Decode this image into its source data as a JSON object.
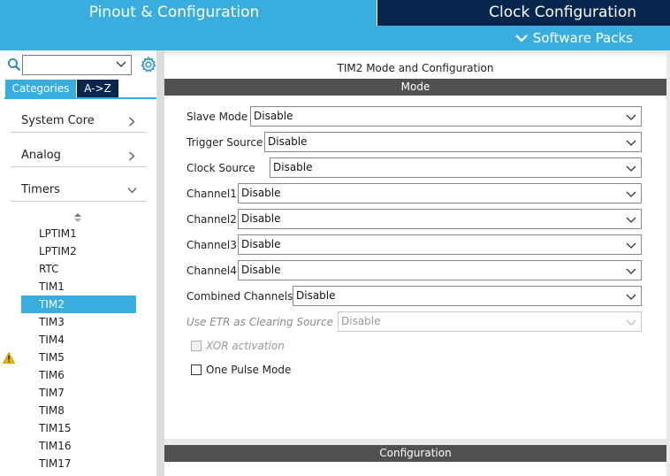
{
  "top_tabs": {
    "pinout": "Pinout & Configuration",
    "clock": "Clock Configuration"
  },
  "software_packs": "Software Packs",
  "left": {
    "search": {
      "value": ""
    },
    "tabs": {
      "categories": "Categories",
      "az": "A->Z"
    },
    "categories": [
      {
        "label": "System Core",
        "state": "collapsed"
      },
      {
        "label": "Analog",
        "state": "collapsed"
      },
      {
        "label": "Timers",
        "state": "expanded"
      }
    ],
    "peripherals": [
      {
        "label": "LPTIM1",
        "warning": false,
        "selected": false
      },
      {
        "label": "LPTIM2",
        "warning": false,
        "selected": false
      },
      {
        "label": "RTC",
        "warning": false,
        "selected": false
      },
      {
        "label": "TIM1",
        "warning": false,
        "selected": false
      },
      {
        "label": "TIM2",
        "warning": false,
        "selected": true
      },
      {
        "label": "TIM3",
        "warning": false,
        "selected": false
      },
      {
        "label": "TIM4",
        "warning": false,
        "selected": false
      },
      {
        "label": "TIM5",
        "warning": true,
        "selected": false
      },
      {
        "label": "TIM6",
        "warning": false,
        "selected": false
      },
      {
        "label": "TIM7",
        "warning": false,
        "selected": false
      },
      {
        "label": "TIM8",
        "warning": false,
        "selected": false
      },
      {
        "label": "TIM15",
        "warning": false,
        "selected": false
      },
      {
        "label": "TIM16",
        "warning": false,
        "selected": false
      },
      {
        "label": "TIM17",
        "warning": false,
        "selected": false
      }
    ]
  },
  "main": {
    "title": "TIM2 Mode and Configuration",
    "mode_header": "Mode",
    "fields": [
      {
        "label": "Slave Mode",
        "value": "Disable",
        "disabled": false
      },
      {
        "label": "Trigger Source",
        "value": "Disable",
        "disabled": false
      },
      {
        "label": "Clock Source",
        "value": "Disable",
        "disabled": false
      },
      {
        "label": "Channel1",
        "value": "Disable",
        "disabled": false
      },
      {
        "label": "Channel2",
        "value": "Disable",
        "disabled": false
      },
      {
        "label": "Channel3",
        "value": "Disable",
        "disabled": false
      },
      {
        "label": "Channel4",
        "value": "Disable",
        "disabled": false
      },
      {
        "label": "Combined Channels",
        "value": "Disable",
        "disabled": false
      },
      {
        "label": "Use ETR as Clearing Source",
        "value": "Disable",
        "disabled": true
      }
    ],
    "checkboxes": [
      {
        "label": "XOR activation",
        "checked": false,
        "disabled": true
      },
      {
        "label": "One Pulse Mode",
        "checked": false,
        "disabled": false
      }
    ],
    "config_header": "Configuration"
  },
  "colors": {
    "accent": "#3aaddf",
    "navy": "#06264d",
    "header_gray": "#505050",
    "warning": "#f0b400"
  },
  "icons": {
    "search": "search-icon",
    "settings": "gear-icon",
    "expand": "chevron-down-icon",
    "collapsed": "chevron-right-icon",
    "sort": "sort-icon",
    "warning": "warning-icon"
  }
}
